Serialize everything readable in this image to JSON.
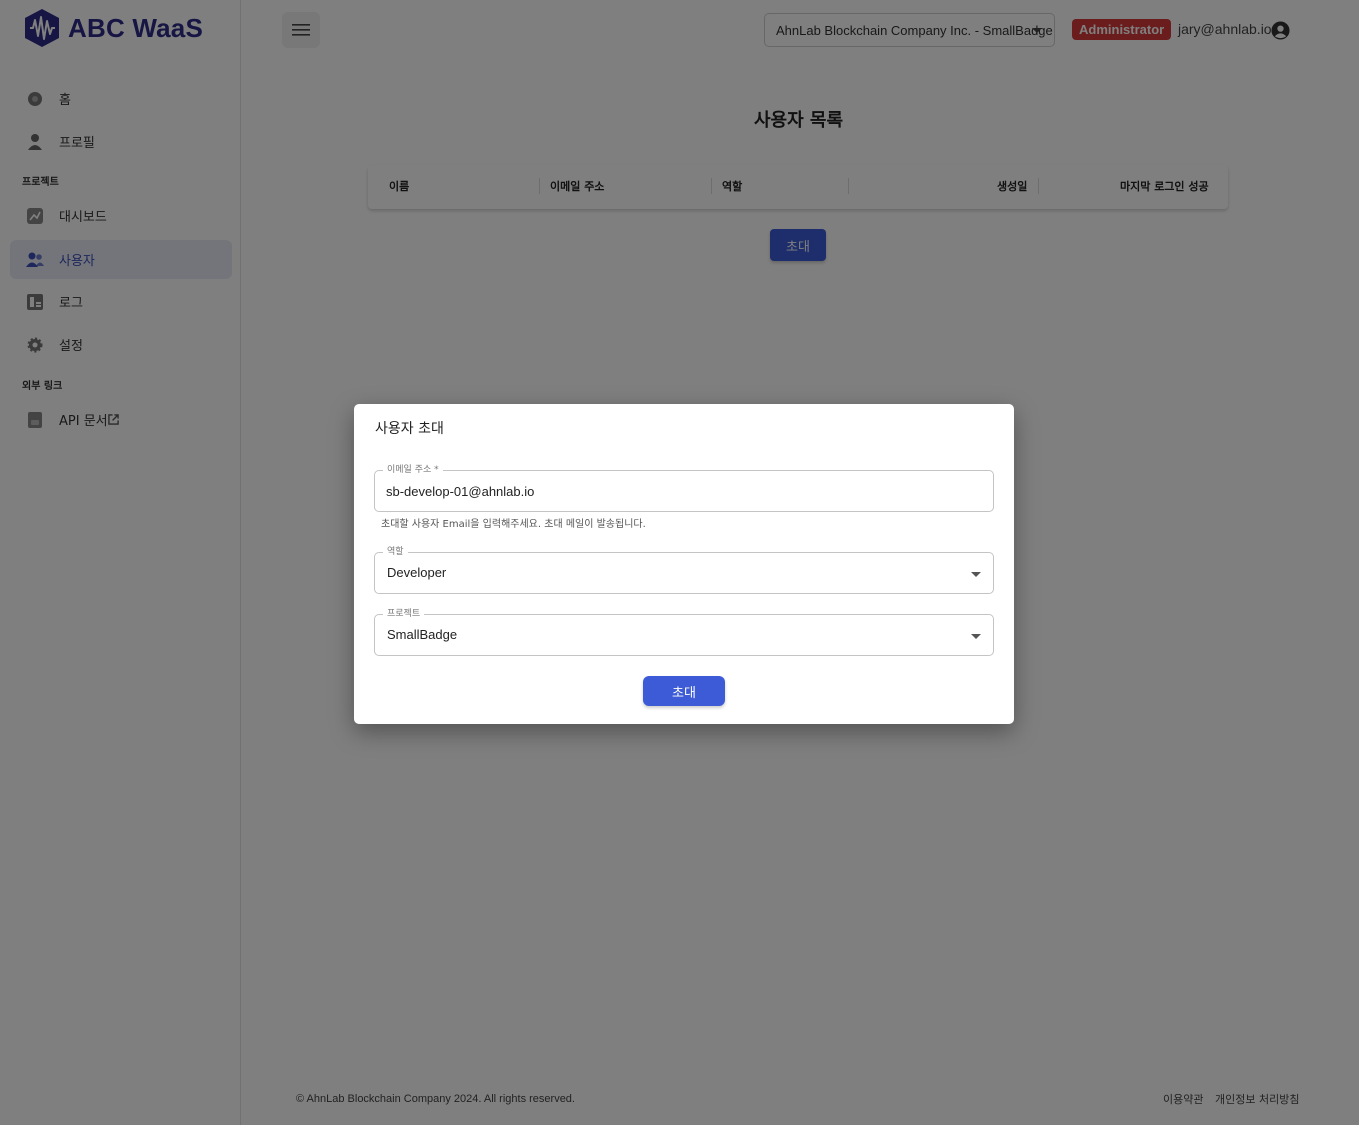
{
  "brand": {
    "name": "ABC WaaS",
    "logo_icon": "waveform-logo-icon",
    "color": "#2c2a87"
  },
  "sidebar": {
    "items": [
      {
        "label": "홈",
        "icon": "home-icon"
      },
      {
        "label": "프로필",
        "icon": "person-icon"
      }
    ],
    "section_project": "프로젝트",
    "project_items": [
      {
        "label": "대시보드",
        "icon": "chart-icon"
      },
      {
        "label": "사용자",
        "icon": "users-icon",
        "active": true
      },
      {
        "label": "로그",
        "icon": "log-icon"
      },
      {
        "label": "설정",
        "icon": "gear-icon"
      }
    ],
    "section_external": "외부 링크",
    "external_items": [
      {
        "label": "API 문서",
        "icon": "document-icon",
        "trailing_icon": "external-link-icon"
      }
    ]
  },
  "header": {
    "org_selected": "AhnLab Blockchain Company Inc. - SmallBadge",
    "role_badge": "Administrator",
    "user_email": "jary@ahnlab.io",
    "badge_color": "#d63a3a"
  },
  "main": {
    "title": "사용자 목록",
    "table_headers": [
      "이름",
      "이메일 주소",
      "역할",
      "생성일",
      "마지막 로그인 성공"
    ],
    "invite_button": "초대"
  },
  "footer": {
    "copyright": "© AhnLab Blockchain Company 2024. All rights reserved.",
    "terms": "이용약관",
    "privacy": "개인정보 처리방침"
  },
  "modal": {
    "title": "사용자 초대",
    "email_label": "이메일 주소 *",
    "email_value": "sb-develop-01@ahnlab.io",
    "helper": "초대할 사용자 Email을 입력해주세요. 초대 메일이 발송됩니다.",
    "role_label": "역할",
    "role_value": "Developer",
    "project_label": "프로젝트",
    "project_value": "SmallBadge",
    "submit": "초대"
  },
  "accent_color": "#3d5bd6"
}
